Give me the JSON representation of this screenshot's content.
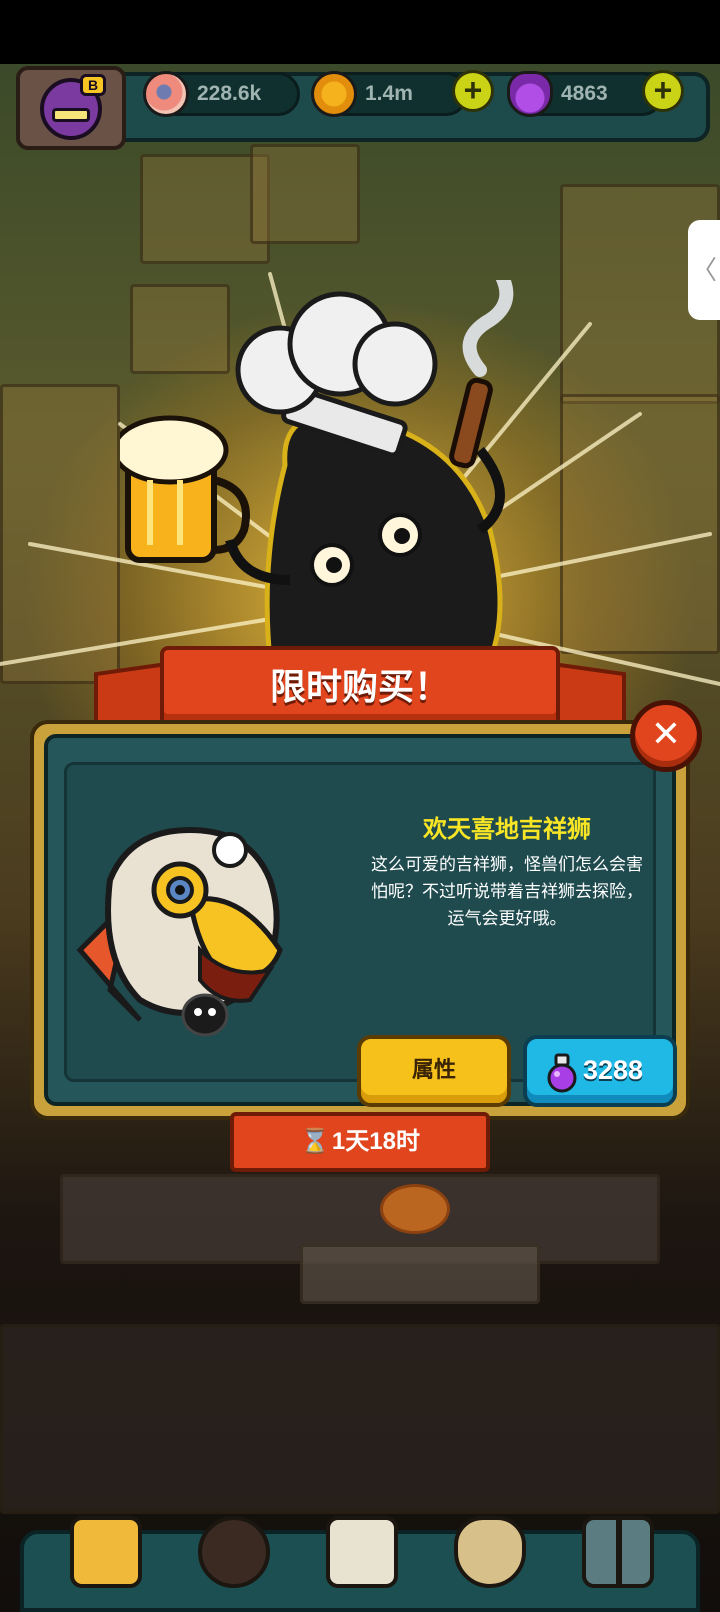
{
  "hud": {
    "resources": [
      {
        "icon": "eyeball-icon",
        "value": "228.6k"
      },
      {
        "icon": "gold-coin-icon",
        "value": "1.4m"
      },
      {
        "icon": "purple-potion-icon",
        "value": "4863"
      }
    ],
    "add_label": "+",
    "avatar_badge": "B"
  },
  "side_tab": {
    "label": "〈"
  },
  "banner": {
    "title": "限时购买！"
  },
  "offer": {
    "name": "欢天喜地吉祥狮",
    "description_lines": [
      "这么可爱的吉祥狮，怪兽们怎么会害",
      "怕呢？不过听说带着吉祥狮去探险，",
      "运气会更好哦。"
    ],
    "attributes_button": "属性",
    "price": "3288",
    "price_icon": "purple-potion-icon",
    "timer": "1天18时",
    "timer_icon": "hourglass-icon"
  },
  "close": {
    "label": "✕"
  },
  "bottom_nav": [
    {
      "icon": "shop-building-icon"
    },
    {
      "icon": "monster-icon"
    },
    {
      "icon": "book-icon"
    },
    {
      "icon": "money-bag-icon"
    },
    {
      "icon": "grid-menu-icon"
    }
  ],
  "colors": {
    "accent_red": "#e0451d",
    "gold_frame": "#c9a23b",
    "panel_teal": "#24565a",
    "title_yellow": "#f8e524",
    "buy_blue": "#20b9e6",
    "attr_yellow": "#f7c11c"
  }
}
